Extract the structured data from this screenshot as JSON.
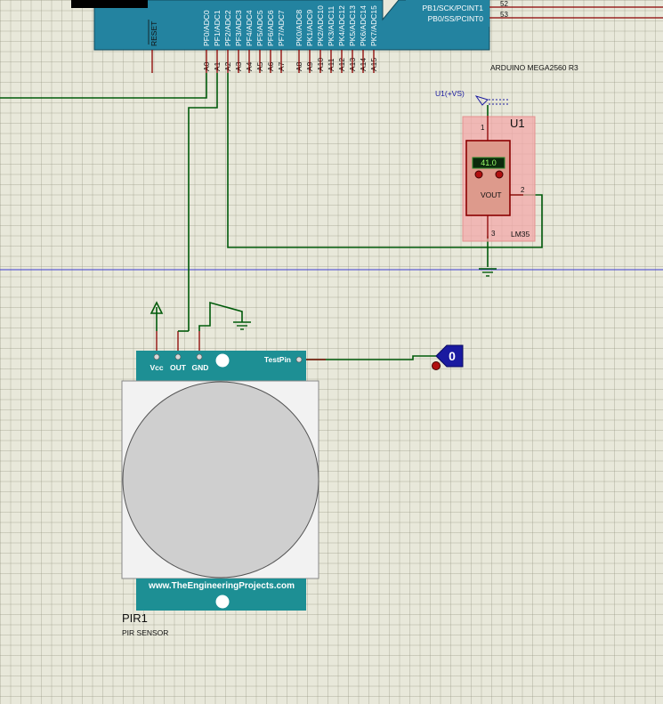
{
  "arduino": {
    "name": "ARDUINO MEGA2560 R3",
    "reset_label": "RESET",
    "pins_top": [
      "PF0/ADC0",
      "PF1/ADC1",
      "PF2/ADC2",
      "PF3/ADC3",
      "PF4/ADC4",
      "PF5/ADC5",
      "PF6/ADC6",
      "PF7/ADC7",
      "PK0/ADC8",
      "PK1/ADC9",
      "PK2/ADC10",
      "PK3/ADC11",
      "PK4/ADC12",
      "PK5/ADC13",
      "PK6/ADC14",
      "PK7/ADC15"
    ],
    "pins_bottom": [
      "A0",
      "A1",
      "A2",
      "A3",
      "A4",
      "A5",
      "A6",
      "A7",
      "A8",
      "A9",
      "A10",
      "A11",
      "A12",
      "A13",
      "A14",
      "A15"
    ],
    "right_pins": [
      {
        "label": "PB1/SCK/PCINT1",
        "num": "52"
      },
      {
        "label": "PB0/SS/PCINT0",
        "num": "53"
      }
    ]
  },
  "lm35": {
    "ref": "U1",
    "name": "LM35",
    "display": "41.0",
    "vout_label": "VOUT",
    "pin1": "1",
    "pin2": "2",
    "pin3": "3",
    "power_label": "U1(+VS)"
  },
  "pir": {
    "ref": "PIR1",
    "name": "PIR SENSOR",
    "pin_vcc": "Vcc",
    "pin_out": "OUT",
    "pin_gnd": "GND",
    "test_pin": "TestPin",
    "website": "www.TheEngineeringProjects.com"
  },
  "logic_probe": {
    "value": "0"
  },
  "colors": {
    "arduino_body": "#2383a0",
    "wire": "#005a0a",
    "pin_line": "#8b0000",
    "pir_teal": "#1d8f94",
    "lm35_body": "#f3a8a8",
    "probe_blue": "#1a1aa0"
  }
}
